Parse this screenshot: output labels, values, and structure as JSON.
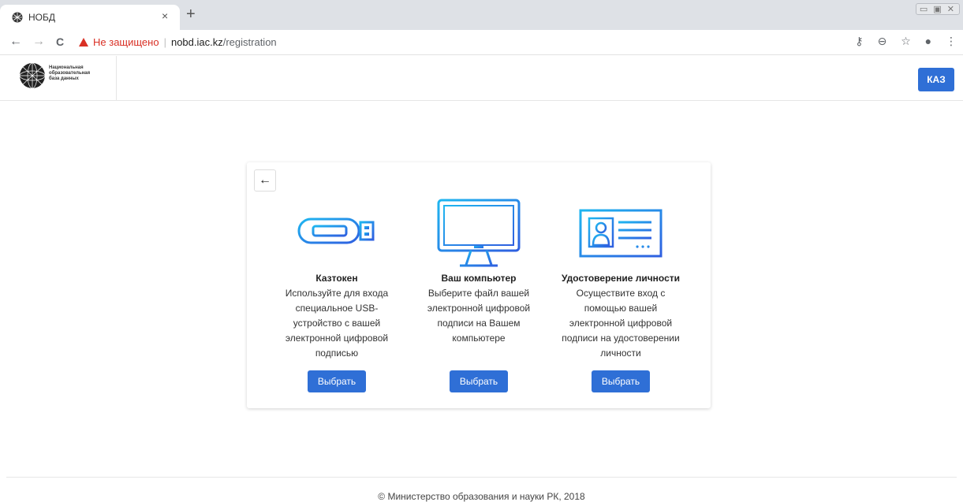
{
  "browser": {
    "tab_title": "НОБД",
    "tab_close": "×",
    "new_tab": "+",
    "window_controls": "▭ ▣ ✕",
    "back": "←",
    "forward": "→",
    "reload": "C",
    "security_warning": "Не защищено",
    "url_host": "nobd.iac.kz",
    "url_path": "/registration",
    "toolbar_icons": [
      "key-icon",
      "zoom-icon",
      "star-icon",
      "account-icon",
      "menu-icon"
    ]
  },
  "header": {
    "logo_lines": [
      "Национальная",
      "образовательная",
      "база данных"
    ],
    "lang_button": "КАЗ"
  },
  "card": {
    "back_icon": "←",
    "options": [
      {
        "icon": "usb-token-icon",
        "title": "Казтокен",
        "description": "Используйте для входа специальное USB-устройство с вашей электронной цифровой подписью",
        "button": "Выбрать"
      },
      {
        "icon": "computer-monitor-icon",
        "title": "Ваш компьютер",
        "description": "Выберите файл вашей электронной цифровой подписи на Вашем компьютере",
        "button": "Выбрать"
      },
      {
        "icon": "id-card-icon",
        "title": "Удостоверение личности",
        "description": "Осуществите вход с помощью вашей электронной цифровой подписи на удостоверении личности",
        "button": "Выбрать"
      }
    ]
  },
  "footer": {
    "copyright": "© Министерство образования и науки РК, 2018"
  },
  "colors": {
    "accent": "#2f6fd6",
    "icon_gradient_start": "#1fb6f0",
    "icon_gradient_end": "#2f5fe0",
    "warning": "#d93025"
  }
}
